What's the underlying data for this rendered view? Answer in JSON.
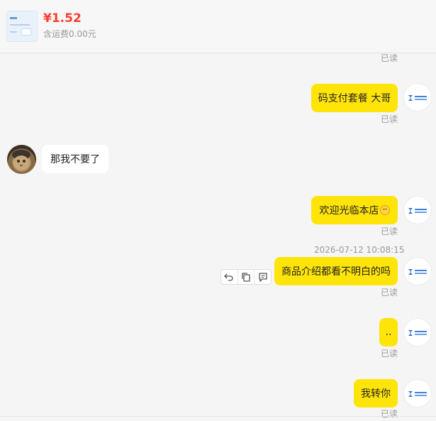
{
  "product": {
    "price": "¥1.52",
    "shipping": "含运费0.00元"
  },
  "messages": [
    {
      "text": "码支付套餐 大哥",
      "read": "已读"
    },
    {
      "text": "那我不要了"
    },
    {
      "text": "欢迎光临本店",
      "emoji": "smiling-face-emoji",
      "read": "已读"
    },
    {
      "text": "商品介绍都看不明白的吗",
      "timestamp": "2026-07-12 10:08:15",
      "read": "已读"
    },
    {
      "text": "..",
      "read": "已读"
    },
    {
      "text": "我转你",
      "read": "已读"
    }
  ],
  "top_read": "已读",
  "icons": {
    "undo": "undo-icon",
    "copy": "copy-icon",
    "quote": "quote-icon"
  },
  "colors": {
    "my_bubble": "#ffe40a",
    "price": "#ff3b2f"
  }
}
